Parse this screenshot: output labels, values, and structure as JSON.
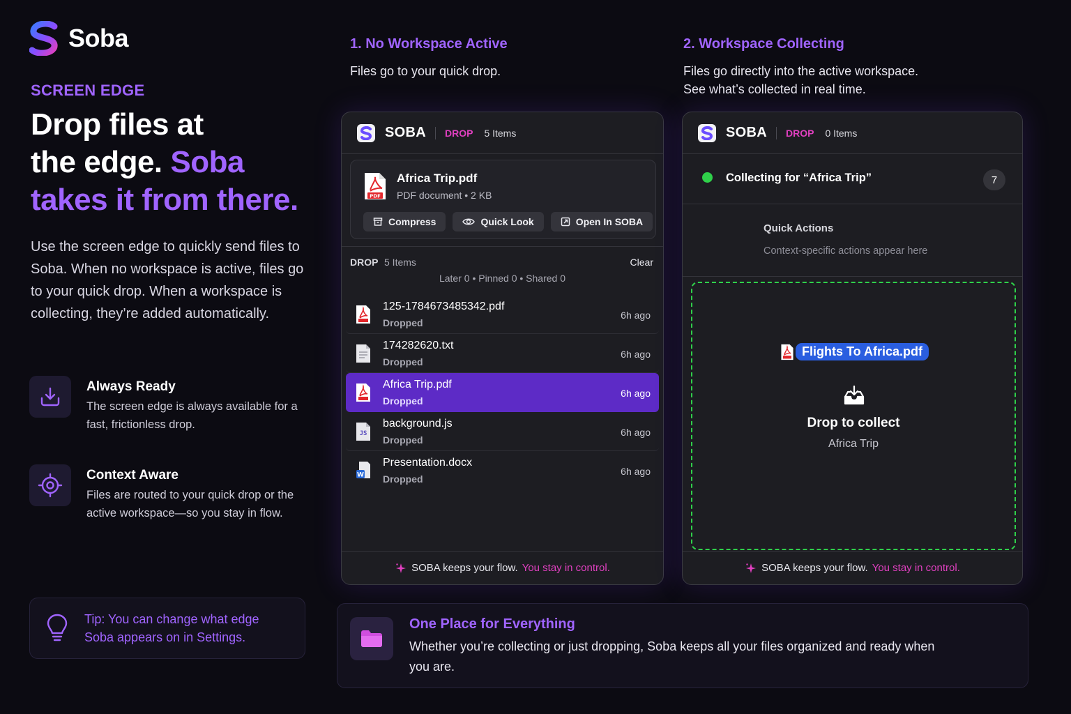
{
  "brand": {
    "name": "Soba"
  },
  "hero": {
    "eyebrow": "SCREEN EDGE",
    "headline_line1": "Drop files at",
    "headline_line2_white": "the edge. ",
    "headline_line2_accent": "Soba",
    "headline_line3": "takes it from there.",
    "lead": "Use the screen edge to quickly send files to Soba. When no workspace is active, files go to your quick drop. When a workspace is collecting, they’re added automatically."
  },
  "features": [
    {
      "title": "Always Ready",
      "desc": "The screen edge is always available for a fast, frictionless drop.",
      "icon": "download-tray-icon"
    },
    {
      "title": "Context Aware",
      "desc": "Files are routed to your quick drop or the active workspace—so you stay in flow.",
      "icon": "crosshair-target-icon"
    }
  ],
  "tip": {
    "text": "Tip: You can change what edge Soba appears on in Settings.",
    "icon": "lightbulb-icon"
  },
  "section1": {
    "title": "1. No Workspace Active",
    "desc": "Files go to your quick drop."
  },
  "section2": {
    "title": "2. Workspace Collecting",
    "desc_line1": "Files go directly into the active workspace.",
    "desc_line2": "See what’s collected in real time."
  },
  "panel1": {
    "app_name": "SOBA",
    "drop_tag": "DROP",
    "items": "5 Items",
    "preview": {
      "name": "Africa Trip.pdf",
      "meta": "PDF document • 2 KB",
      "actions": [
        "Compress",
        "Quick Look",
        "Open In SOBA"
      ]
    },
    "list": {
      "label": "DROP",
      "count": "5 Items",
      "clear": "Clear",
      "stats": "Later 0 • Pinned 0 • Shared 0"
    },
    "files": [
      {
        "name": "125-1784673485342.pdf",
        "status": "Dropped",
        "time": "6h ago",
        "type": "pdf"
      },
      {
        "name": "174282620.txt",
        "status": "Dropped",
        "time": "6h ago",
        "type": "txt"
      },
      {
        "name": "Africa Trip.pdf",
        "status": "Dropped",
        "time": "6h ago",
        "type": "pdf"
      },
      {
        "name": "background.js",
        "status": "Dropped",
        "time": "6h ago",
        "type": "js"
      },
      {
        "name": "Presentation.docx",
        "status": "Dropped",
        "time": "6h ago",
        "type": "docx"
      }
    ],
    "footer_white": "SOBA keeps your flow.",
    "footer_pink": "You stay in control."
  },
  "panel2": {
    "app_name": "SOBA",
    "drop_tag": "DROP",
    "items": "0 Items",
    "collecting": "Collecting for “Africa Trip”",
    "badge": "7",
    "quick_actions_title": "Quick Actions",
    "quick_actions_sub": "Context-specific actions appear here",
    "dragged_file": "Flights To Africa.pdf",
    "drop_title": "Drop to collect",
    "drop_sub": "Africa Trip",
    "footer_white": "SOBA keeps your flow.",
    "footer_pink": "You stay in control."
  },
  "banner": {
    "title": "One Place for Everything",
    "desc": "Whether you’re collecting or just dropping, Soba keeps all your files organized and ready when you are.",
    "icon": "folder-icon"
  },
  "colors": {
    "accent": "#a064ff",
    "pink": "#e040c0",
    "selected": "#5d2bc6",
    "green": "#2fd04a",
    "background": "#0c0b12"
  }
}
